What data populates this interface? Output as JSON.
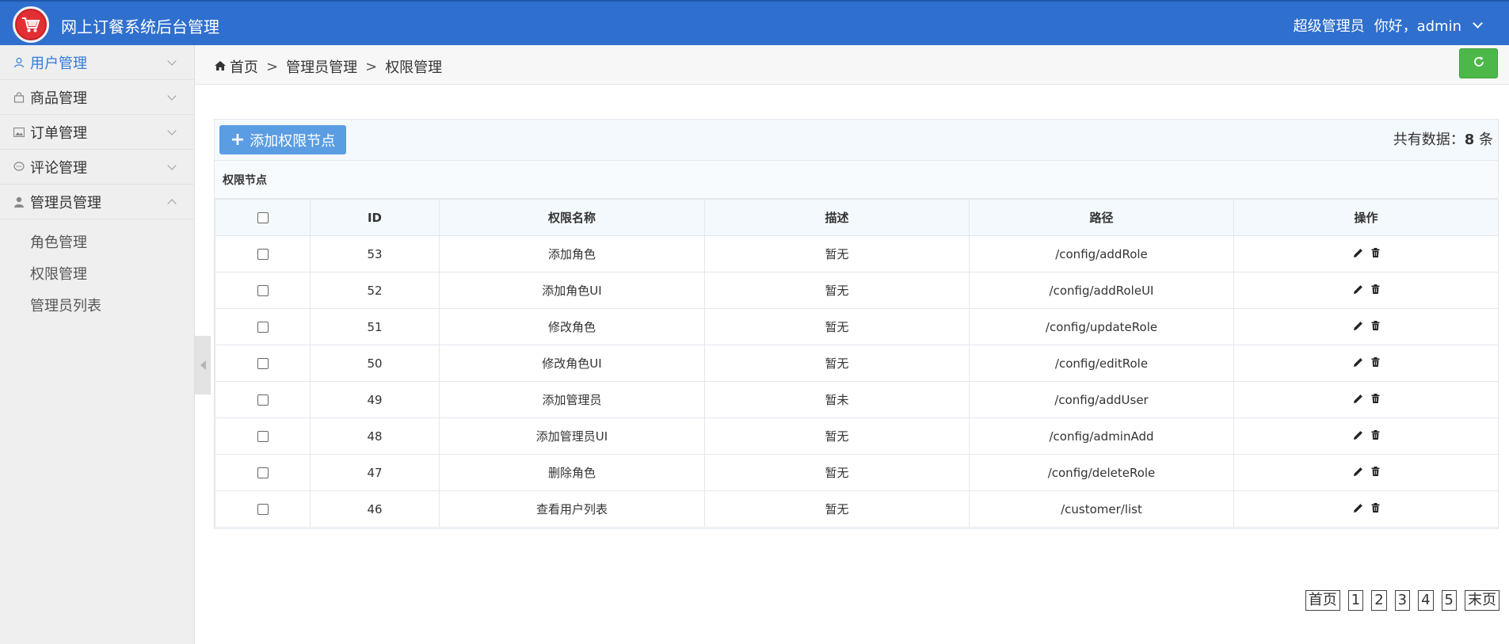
{
  "header": {
    "app_title": "网上订餐系统后台管理",
    "role": "超级管理员",
    "greeting": "你好，admin"
  },
  "sidebar": {
    "items": [
      {
        "label": "用户管理",
        "icon": "user-icon",
        "active": true,
        "expanded": false
      },
      {
        "label": "商品管理",
        "icon": "bag-icon",
        "active": false,
        "expanded": false
      },
      {
        "label": "订单管理",
        "icon": "image-icon",
        "active": false,
        "expanded": false
      },
      {
        "label": "评论管理",
        "icon": "comment-icon",
        "active": false,
        "expanded": false
      },
      {
        "label": "管理员管理",
        "icon": "person-icon",
        "active": false,
        "expanded": true
      }
    ],
    "subitems": [
      "角色管理",
      "权限管理",
      "管理员列表"
    ]
  },
  "breadcrumb": {
    "home": "首页",
    "sep1": ">",
    "level1": "管理员管理",
    "sep2": ">",
    "level2": "权限管理"
  },
  "toolbar": {
    "add_label": "添加权限节点",
    "count_prefix": "共有数据：",
    "count_value": "8",
    "count_suffix": " 条"
  },
  "table": {
    "caption": "权限节点",
    "columns": [
      "ID",
      "权限名称",
      "描述",
      "路径",
      "操作"
    ],
    "rows": [
      {
        "id": "53",
        "name": "添加角色",
        "desc": "暂无",
        "path": "/config/addRole"
      },
      {
        "id": "52",
        "name": "添加角色UI",
        "desc": "暂无",
        "path": "/config/addRoleUI"
      },
      {
        "id": "51",
        "name": "修改角色",
        "desc": "暂无",
        "path": "/config/updateRole"
      },
      {
        "id": "50",
        "name": "修改角色UI",
        "desc": "暂无",
        "path": "/config/editRole"
      },
      {
        "id": "49",
        "name": "添加管理员",
        "desc": "暂未",
        "path": "/config/addUser"
      },
      {
        "id": "48",
        "name": "添加管理员UI",
        "desc": "暂无",
        "path": "/config/adminAdd"
      },
      {
        "id": "47",
        "name": "删除角色",
        "desc": "暂无",
        "path": "/config/deleteRole"
      },
      {
        "id": "46",
        "name": "查看用户列表",
        "desc": "暂无",
        "path": "/customer/list"
      }
    ]
  },
  "pagination": {
    "first": "首页",
    "pages": [
      "1",
      "2",
      "3",
      "4",
      "5"
    ],
    "last": "末页"
  },
  "colors": {
    "header_bg": "#2f6fce",
    "accent": "#2f7bd8",
    "add_button": "#5a9de3",
    "refresh_button": "#4cb84a"
  }
}
